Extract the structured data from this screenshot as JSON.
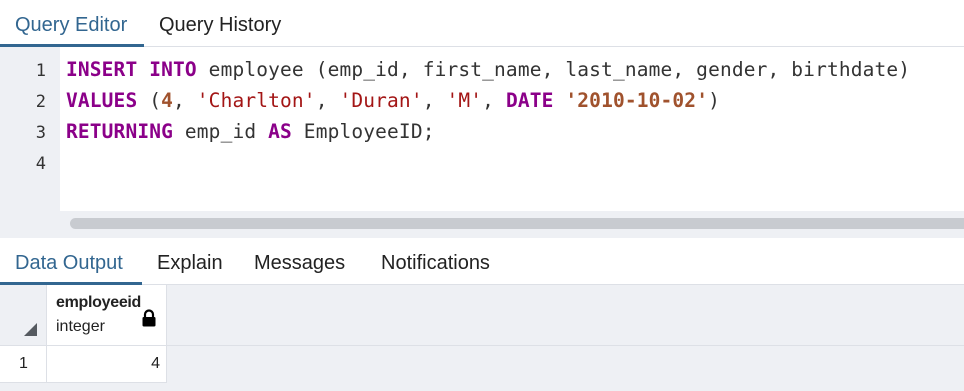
{
  "editor_tabs": [
    {
      "label": "Query Editor",
      "active": true
    },
    {
      "label": "Query History",
      "active": false
    }
  ],
  "editor": {
    "line_numbers": [
      "1",
      "2",
      "3",
      "4"
    ],
    "lines": [
      [
        {
          "t": "INSERT",
          "c": "kw"
        },
        {
          "t": " ",
          "c": ""
        },
        {
          "t": "INTO",
          "c": "kw"
        },
        {
          "t": " employee (emp_id, first_name, last_name, gender, birthdate)",
          "c": ""
        }
      ],
      [
        {
          "t": "VALUES",
          "c": "kw"
        },
        {
          "t": " (",
          "c": ""
        },
        {
          "t": "4",
          "c": "num"
        },
        {
          "t": ", ",
          "c": ""
        },
        {
          "t": "'Charlton'",
          "c": "str"
        },
        {
          "t": ", ",
          "c": ""
        },
        {
          "t": "'Duran'",
          "c": "str"
        },
        {
          "t": ", ",
          "c": ""
        },
        {
          "t": "'M'",
          "c": "str"
        },
        {
          "t": ", ",
          "c": ""
        },
        {
          "t": "DATE",
          "c": "kw"
        },
        {
          "t": " ",
          "c": ""
        },
        {
          "t": "'2010-10-02'",
          "c": "num"
        },
        {
          "t": ")",
          "c": ""
        }
      ],
      [
        {
          "t": "RETURNING",
          "c": "kw"
        },
        {
          "t": " emp_id ",
          "c": ""
        },
        {
          "t": "AS",
          "c": "kw"
        },
        {
          "t": " EmployeeID;",
          "c": ""
        }
      ],
      []
    ]
  },
  "output_tabs": [
    {
      "label": "Data Output",
      "active": true
    },
    {
      "label": "Explain",
      "active": false
    },
    {
      "label": "Messages",
      "active": false
    },
    {
      "label": "Notifications",
      "active": false
    }
  ],
  "result_grid": {
    "columns": [
      {
        "name": "employeeid",
        "type": "integer",
        "icon": "lock-icon"
      }
    ],
    "rows": [
      {
        "row_number": "1",
        "values": [
          "4"
        ]
      }
    ]
  },
  "colors": {
    "accent": "#326690",
    "keyword": "#8b0089",
    "string": "#a31515",
    "number": "#a0522d",
    "panel_gray": "#eef0f4"
  }
}
